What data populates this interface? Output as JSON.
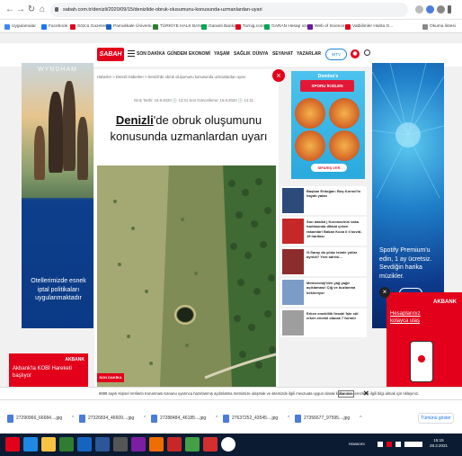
{
  "browser": {
    "url": "sabah.com.tr/denizli/2020/09/15/denizlide-obruk-olusumunu-konusunda-uzmanlardan-uyari",
    "bookmarks": [
      {
        "label": "Uygulamalar",
        "color": "#4285f4"
      },
      {
        "label": "Facebook",
        "color": "#1877f2"
      },
      {
        "label": "Sözcü Gazetesi",
        "color": "#e2001a"
      },
      {
        "label": "Pamukkale Üniversi...",
        "color": "#1565c0"
      },
      {
        "label": "TÜRKİYE HALK BAN...",
        "color": "#2e7d32"
      },
      {
        "label": "Garanti Bankası",
        "color": "#00a651"
      },
      {
        "label": "Turnig.com",
        "color": "#e2001a"
      },
      {
        "label": "GARAN Hesap ozet...",
        "color": "#00a651"
      },
      {
        "label": "Web of Science",
        "color": "#6a1b9a"
      },
      {
        "label": "Vatbilimler Harita G...",
        "color": "#e2001a"
      }
    ],
    "bookmarks_right": "Okuma listesi"
  },
  "site": {
    "logo": "SABAH",
    "nav": [
      "SON DAKİKA",
      "GÜNDEM",
      "EKONOMİ",
      "YAŞAM",
      "SAĞLIK",
      "DÜNYA",
      "SEYAHAT",
      "YAZARLAR"
    ],
    "wtv": "WTV"
  },
  "left_ad": {
    "brand": "WYNDHAM",
    "text": "Otellerimizde esnek iptal politikaları uygulanmaktadır"
  },
  "article": {
    "breadcrumb": "Haberler > Denizli Haberleri > Denizli'de obruk oluşumunu konusunda uzmanlardan uyarı",
    "dates": "Giriş Tarihi: 15.9.2020 🕐 13:31   Son Güncelleme: 15.9.2020 🕐 14:11",
    "headline_place": "Denizli",
    "headline_rest": "'de obruk oluşumunu konusunda uzmanlardan uyarı",
    "badge": "SON DAKİKA"
  },
  "dominos": {
    "header": "Domino's",
    "band": "SPORU İKSİLEN",
    "cta": "SİPARİŞ VER"
  },
  "news": [
    {
      "text": "Başkan Erdoğan: Boş Kornol'in hayatı yalan",
      "thumb": "#2c4a7a"
    },
    {
      "text": "Son dakika | Koronavirüs vaka haritasında dikkat çeken rakamlar! Bakan Koca il il kovid-19 haritası",
      "thumb": "#c62828"
    },
    {
      "text": "G.Saray da yıldız isimle yollar ayrıldı? Yeni adresi...",
      "thumb": "#8d2c2c"
    },
    {
      "text": "Meteoroloji'den yağ yağır açıklaması! Çığ ve buzlanma bekleniyor",
      "thumb": "#7a9cc6"
    },
    {
      "text": "Erken emeklilik fırsatı! İşte süt erken emekli olacak 7 formül",
      "thumb": "#9e9e9e"
    }
  ],
  "akbank_small": {
    "logo": "AKBANK",
    "text": "Akbank'la KOBİ Hareketi başlıyor"
  },
  "spotify": {
    "text": "Spotify Premium'u edin, 1 ay ücretsiz. Sevdiğin harika müzikler."
  },
  "akbank_big": {
    "logo": "AKBANK",
    "text": "Hesaplarınız kolayca ulaş"
  },
  "cookie": {
    "text": "6698 sayılı Kişisel Verilerin Korunması Kanunu uyarınca hazırlanmış aydınlatma metnimize ulaşmak ve sitemizde ilgili mevzuata uygun olarak kullanılan çerezlerle ilgili bilgi almak için tıklayınız.",
    "button": "Kabul et"
  },
  "downloads": [
    {
      "name": "27290966_66684....jpg"
    },
    {
      "name": "27326834_46609....jpg"
    },
    {
      "name": "27288484_46185....jpg"
    },
    {
      "name": "27637252_43545....jpg"
    },
    {
      "name": "27356677_97595....jpg"
    }
  ],
  "downloads_showall": "Tümünü göster",
  "taskbar": {
    "tray": "Havacını",
    "time": "15:15",
    "date": "28.3.2021"
  }
}
